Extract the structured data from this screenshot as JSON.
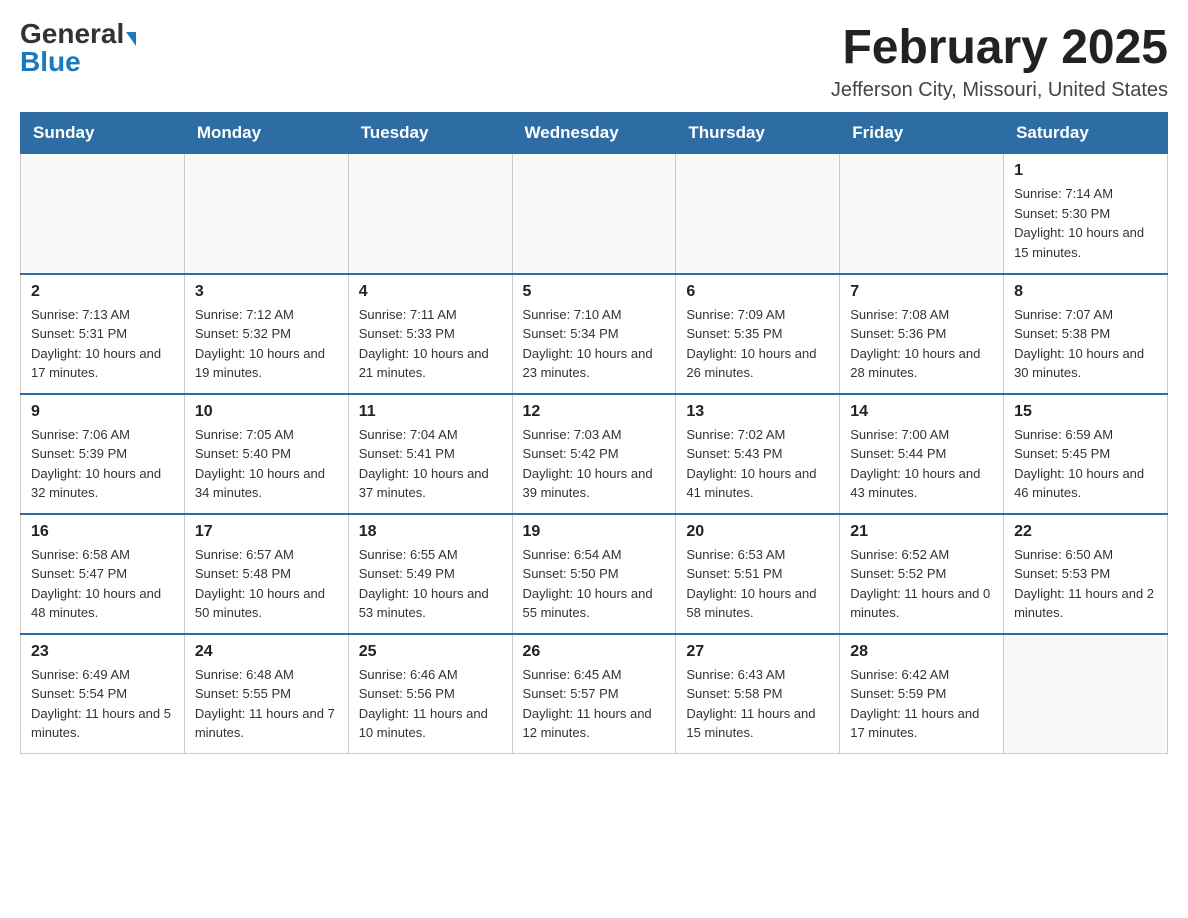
{
  "header": {
    "logo_general": "General",
    "logo_blue": "Blue",
    "month_title": "February 2025",
    "location": "Jefferson City, Missouri, United States"
  },
  "days_of_week": [
    "Sunday",
    "Monday",
    "Tuesday",
    "Wednesday",
    "Thursday",
    "Friday",
    "Saturday"
  ],
  "weeks": [
    [
      {
        "day": "",
        "info": ""
      },
      {
        "day": "",
        "info": ""
      },
      {
        "day": "",
        "info": ""
      },
      {
        "day": "",
        "info": ""
      },
      {
        "day": "",
        "info": ""
      },
      {
        "day": "",
        "info": ""
      },
      {
        "day": "1",
        "info": "Sunrise: 7:14 AM\nSunset: 5:30 PM\nDaylight: 10 hours and 15 minutes."
      }
    ],
    [
      {
        "day": "2",
        "info": "Sunrise: 7:13 AM\nSunset: 5:31 PM\nDaylight: 10 hours and 17 minutes."
      },
      {
        "day": "3",
        "info": "Sunrise: 7:12 AM\nSunset: 5:32 PM\nDaylight: 10 hours and 19 minutes."
      },
      {
        "day": "4",
        "info": "Sunrise: 7:11 AM\nSunset: 5:33 PM\nDaylight: 10 hours and 21 minutes."
      },
      {
        "day": "5",
        "info": "Sunrise: 7:10 AM\nSunset: 5:34 PM\nDaylight: 10 hours and 23 minutes."
      },
      {
        "day": "6",
        "info": "Sunrise: 7:09 AM\nSunset: 5:35 PM\nDaylight: 10 hours and 26 minutes."
      },
      {
        "day": "7",
        "info": "Sunrise: 7:08 AM\nSunset: 5:36 PM\nDaylight: 10 hours and 28 minutes."
      },
      {
        "day": "8",
        "info": "Sunrise: 7:07 AM\nSunset: 5:38 PM\nDaylight: 10 hours and 30 minutes."
      }
    ],
    [
      {
        "day": "9",
        "info": "Sunrise: 7:06 AM\nSunset: 5:39 PM\nDaylight: 10 hours and 32 minutes."
      },
      {
        "day": "10",
        "info": "Sunrise: 7:05 AM\nSunset: 5:40 PM\nDaylight: 10 hours and 34 minutes."
      },
      {
        "day": "11",
        "info": "Sunrise: 7:04 AM\nSunset: 5:41 PM\nDaylight: 10 hours and 37 minutes."
      },
      {
        "day": "12",
        "info": "Sunrise: 7:03 AM\nSunset: 5:42 PM\nDaylight: 10 hours and 39 minutes."
      },
      {
        "day": "13",
        "info": "Sunrise: 7:02 AM\nSunset: 5:43 PM\nDaylight: 10 hours and 41 minutes."
      },
      {
        "day": "14",
        "info": "Sunrise: 7:00 AM\nSunset: 5:44 PM\nDaylight: 10 hours and 43 minutes."
      },
      {
        "day": "15",
        "info": "Sunrise: 6:59 AM\nSunset: 5:45 PM\nDaylight: 10 hours and 46 minutes."
      }
    ],
    [
      {
        "day": "16",
        "info": "Sunrise: 6:58 AM\nSunset: 5:47 PM\nDaylight: 10 hours and 48 minutes."
      },
      {
        "day": "17",
        "info": "Sunrise: 6:57 AM\nSunset: 5:48 PM\nDaylight: 10 hours and 50 minutes."
      },
      {
        "day": "18",
        "info": "Sunrise: 6:55 AM\nSunset: 5:49 PM\nDaylight: 10 hours and 53 minutes."
      },
      {
        "day": "19",
        "info": "Sunrise: 6:54 AM\nSunset: 5:50 PM\nDaylight: 10 hours and 55 minutes."
      },
      {
        "day": "20",
        "info": "Sunrise: 6:53 AM\nSunset: 5:51 PM\nDaylight: 10 hours and 58 minutes."
      },
      {
        "day": "21",
        "info": "Sunrise: 6:52 AM\nSunset: 5:52 PM\nDaylight: 11 hours and 0 minutes."
      },
      {
        "day": "22",
        "info": "Sunrise: 6:50 AM\nSunset: 5:53 PM\nDaylight: 11 hours and 2 minutes."
      }
    ],
    [
      {
        "day": "23",
        "info": "Sunrise: 6:49 AM\nSunset: 5:54 PM\nDaylight: 11 hours and 5 minutes."
      },
      {
        "day": "24",
        "info": "Sunrise: 6:48 AM\nSunset: 5:55 PM\nDaylight: 11 hours and 7 minutes."
      },
      {
        "day": "25",
        "info": "Sunrise: 6:46 AM\nSunset: 5:56 PM\nDaylight: 11 hours and 10 minutes."
      },
      {
        "day": "26",
        "info": "Sunrise: 6:45 AM\nSunset: 5:57 PM\nDaylight: 11 hours and 12 minutes."
      },
      {
        "day": "27",
        "info": "Sunrise: 6:43 AM\nSunset: 5:58 PM\nDaylight: 11 hours and 15 minutes."
      },
      {
        "day": "28",
        "info": "Sunrise: 6:42 AM\nSunset: 5:59 PM\nDaylight: 11 hours and 17 minutes."
      },
      {
        "day": "",
        "info": ""
      }
    ]
  ]
}
